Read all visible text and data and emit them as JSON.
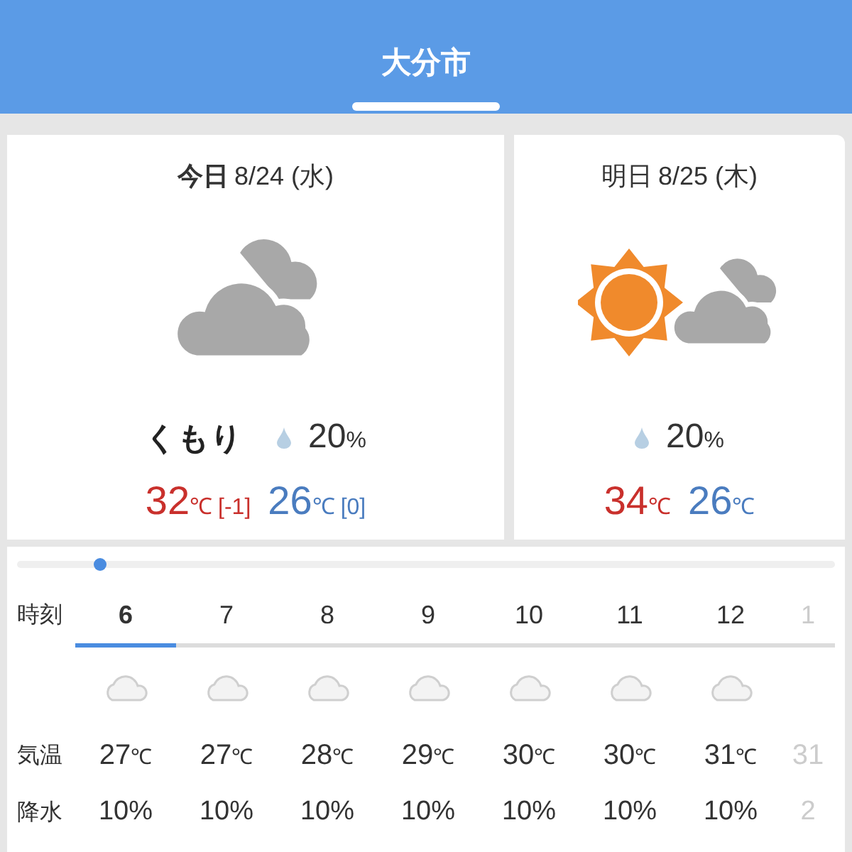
{
  "header": {
    "title": "大分市"
  },
  "days": [
    {
      "label": "今日",
      "date": "8/24 (水)",
      "kind": "cloudy",
      "condition": "くもり",
      "rain": "20",
      "rain_unit": "%",
      "high": "32",
      "high_unit": "℃",
      "high_diff": "[-1]",
      "low": "26",
      "low_unit": "℃",
      "low_diff": "[0]"
    },
    {
      "label": "明日",
      "date": "8/25 (木)",
      "kind": "sun_cloud",
      "rain": "20",
      "rain_unit": "%",
      "high": "34",
      "high_unit": "℃",
      "low": "26",
      "low_unit": "℃"
    }
  ],
  "timeline": {
    "level": 0.1
  },
  "hourly": {
    "row_labels": [
      "時刻",
      "気温",
      "降水"
    ],
    "hours": [
      {
        "hour": "6",
        "temp": "27",
        "temp_unit": "℃",
        "rain": "10%",
        "selected": true
      },
      {
        "hour": "7",
        "temp": "27",
        "temp_unit": "℃",
        "rain": "10%",
        "selected": false
      },
      {
        "hour": "8",
        "temp": "28",
        "temp_unit": "℃",
        "rain": "10%",
        "selected": false
      },
      {
        "hour": "9",
        "temp": "29",
        "temp_unit": "℃",
        "rain": "10%",
        "selected": false
      },
      {
        "hour": "10",
        "temp": "30",
        "temp_unit": "℃",
        "rain": "10%",
        "selected": false
      },
      {
        "hour": "11",
        "temp": "30",
        "temp_unit": "℃",
        "rain": "10%",
        "selected": false
      },
      {
        "hour": "12",
        "temp": "31",
        "temp_unit": "℃",
        "rain": "10%",
        "selected": false
      },
      {
        "hour": "1",
        "temp": "31",
        "rain": "2",
        "selected": false,
        "faded": true
      }
    ]
  }
}
